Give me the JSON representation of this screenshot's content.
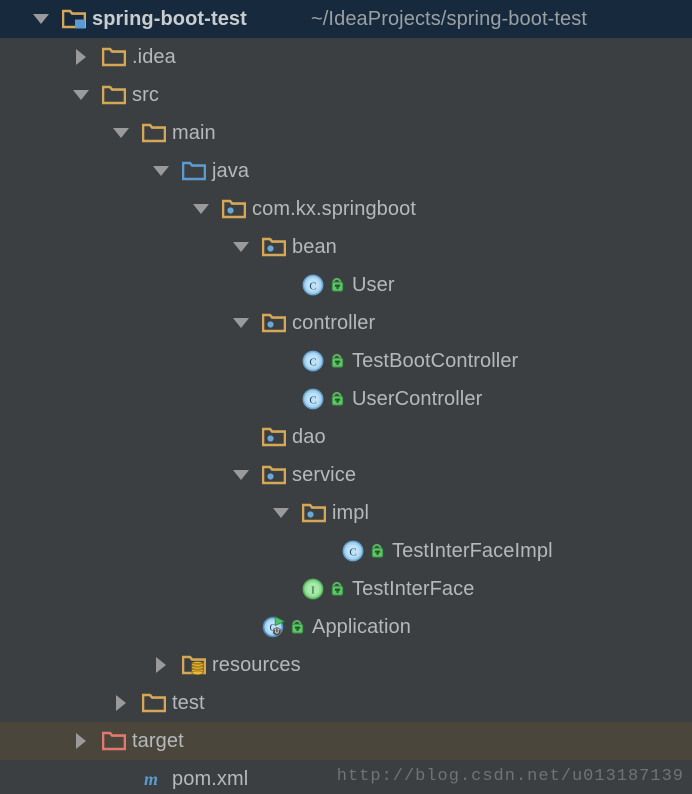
{
  "window": {
    "background_color": "#3c3f41",
    "selected_row_color": "#16293d",
    "highlight_row_color": "#4b463c",
    "text_color": "#b5b9ba"
  },
  "watermark": {
    "text": "http://blog.csdn.net/u013187139"
  },
  "tree": {
    "rows": [
      {
        "label": "spring-boot-test",
        "secondary": "~/IdeaProjects/spring-boot-test",
        "icon": "project-folder-icon",
        "arrow": "open",
        "depth": 0,
        "selected": true,
        "bold": true
      },
      {
        "label": ".idea",
        "secondary": "",
        "icon": "folder-icon",
        "arrow": "closed",
        "depth": 1,
        "selected": false,
        "bold": false
      },
      {
        "label": "src",
        "secondary": "",
        "icon": "folder-icon",
        "arrow": "open",
        "depth": 1,
        "selected": false,
        "bold": false
      },
      {
        "label": "main",
        "secondary": "",
        "icon": "folder-icon",
        "arrow": "open",
        "depth": 2,
        "selected": false,
        "bold": false
      },
      {
        "label": "java",
        "secondary": "",
        "icon": "source-root-folder-icon",
        "arrow": "open",
        "depth": 3,
        "selected": false,
        "bold": false
      },
      {
        "label": "com.kx.springboot",
        "secondary": "",
        "icon": "package-icon",
        "arrow": "open",
        "depth": 4,
        "selected": false,
        "bold": false
      },
      {
        "label": "bean",
        "secondary": "",
        "icon": "package-icon",
        "arrow": "open",
        "depth": 5,
        "selected": false,
        "bold": false
      },
      {
        "label": "User",
        "secondary": "",
        "icon": "java-class-icon",
        "lock": "public-unlocked-icon",
        "arrow": "none",
        "depth": 6,
        "selected": false,
        "bold": false
      },
      {
        "label": "controller",
        "secondary": "",
        "icon": "package-icon",
        "arrow": "open",
        "depth": 5,
        "selected": false,
        "bold": false
      },
      {
        "label": "TestBootController",
        "secondary": "",
        "icon": "java-class-icon",
        "lock": "public-unlocked-icon",
        "arrow": "none",
        "depth": 6,
        "selected": false,
        "bold": false
      },
      {
        "label": "UserController",
        "secondary": "",
        "icon": "java-class-icon",
        "lock": "public-unlocked-icon",
        "arrow": "none",
        "depth": 6,
        "selected": false,
        "bold": false
      },
      {
        "label": "dao",
        "secondary": "",
        "icon": "package-icon",
        "arrow": "none",
        "depth": 5,
        "selected": false,
        "bold": false
      },
      {
        "label": "service",
        "secondary": "",
        "icon": "package-icon",
        "arrow": "open",
        "depth": 5,
        "selected": false,
        "bold": false
      },
      {
        "label": "impl",
        "secondary": "",
        "icon": "package-icon",
        "arrow": "open",
        "depth": 6,
        "selected": false,
        "bold": false
      },
      {
        "label": "TestInterFaceImpl",
        "secondary": "",
        "icon": "java-class-icon",
        "lock": "public-unlocked-icon",
        "arrow": "none",
        "depth": 7,
        "selected": false,
        "bold": false
      },
      {
        "label": "TestInterFace",
        "secondary": "",
        "icon": "java-interface-icon",
        "lock": "public-unlocked-icon",
        "arrow": "none",
        "depth": 6,
        "selected": false,
        "bold": false
      },
      {
        "label": "Application",
        "secondary": "",
        "icon": "runnable-java-class-icon",
        "lock": "public-unlocked-icon",
        "arrow": "none",
        "depth": 5,
        "selected": false,
        "bold": false
      },
      {
        "label": "resources",
        "secondary": "",
        "icon": "resources-root-folder-icon",
        "arrow": "closed",
        "depth": 3,
        "selected": false,
        "bold": false
      },
      {
        "label": "test",
        "secondary": "",
        "icon": "folder-icon",
        "arrow": "closed",
        "depth": 2,
        "selected": false,
        "bold": false
      },
      {
        "label": "target",
        "secondary": "",
        "icon": "excluded-folder-icon",
        "arrow": "closed",
        "depth": 1,
        "selected": false,
        "highlight": true,
        "bold": false
      },
      {
        "label": "pom.xml",
        "secondary": "",
        "icon": "maven-pom-icon",
        "arrow": "none",
        "depth": 2,
        "selected": false,
        "bold": false
      }
    ]
  }
}
